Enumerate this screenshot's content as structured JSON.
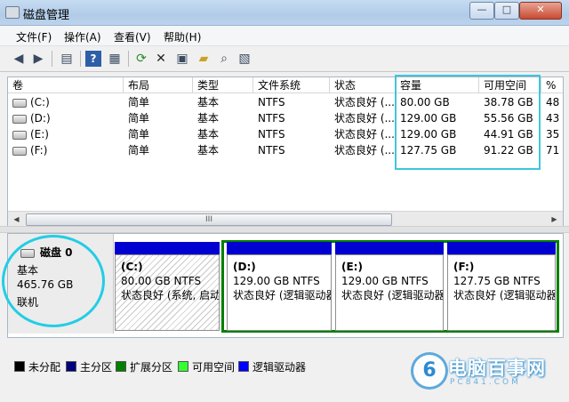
{
  "window": {
    "title": "磁盘管理",
    "controls": {
      "minimize": "—",
      "maximize": "□",
      "close": "✕"
    }
  },
  "menu": [
    "文件(F)",
    "操作(A)",
    "查看(V)",
    "帮助(H)"
  ],
  "toolbar_icons": [
    "back-arrow-icon",
    "forward-arrow-icon",
    "console-tree-icon",
    "help-icon",
    "properties-icon",
    "refresh-icon",
    "delete-icon",
    "export-icon",
    "open-icon",
    "search-icon",
    "settings-icon"
  ],
  "volume_table": {
    "columns": [
      "卷",
      "布局",
      "类型",
      "文件系统",
      "状态",
      "容量",
      "可用空间",
      "%"
    ],
    "rows": [
      [
        "(C:)",
        "简单",
        "基本",
        "NTFS",
        "状态良好 (...",
        "80.00 GB",
        "38.78 GB",
        "48"
      ],
      [
        "(D:)",
        "简单",
        "基本",
        "NTFS",
        "状态良好 (...",
        "129.00 GB",
        "55.56 GB",
        "43"
      ],
      [
        "(E:)",
        "简单",
        "基本",
        "NTFS",
        "状态良好 (...",
        "129.00 GB",
        "44.91 GB",
        "35"
      ],
      [
        "(F:)",
        "简单",
        "基本",
        "NTFS",
        "状态良好 (...",
        "127.75 GB",
        "91.22 GB",
        "71"
      ]
    ]
  },
  "disk": {
    "name": "磁盘 0",
    "type": "基本",
    "size": "465.76 GB",
    "status": "联机"
  },
  "partitions": [
    {
      "name": "(C:)",
      "size_fs": "80.00 GB NTFS",
      "status": "状态良好 (系统, 启动"
    },
    {
      "name": "(D:)",
      "size_fs": "129.00 GB NTFS",
      "status": "状态良好 (逻辑驱动器"
    },
    {
      "name": "(E:)",
      "size_fs": "129.00 GB NTFS",
      "status": "状态良好 (逻辑驱动器"
    },
    {
      "name": "(F:)",
      "size_fs": "127.75 GB NTFS",
      "status": "状态良好 (逻辑驱动器"
    }
  ],
  "legend": [
    {
      "label": "未分配",
      "color": "#000000"
    },
    {
      "label": "主分区",
      "color": "#00007f"
    },
    {
      "label": "扩展分区",
      "color": "#008000"
    },
    {
      "label": "可用空间",
      "color": "#33ff33"
    },
    {
      "label": "逻辑驱动器",
      "color": "#0000ff"
    }
  ],
  "scrollbar": {
    "thumb_grip": "III"
  },
  "watermark": {
    "logo": "6",
    "text": "电脑百事网",
    "sub": "PC841.COM"
  },
  "colors": {
    "highlight": "#3ec6dd",
    "partition_bar": "#0000d0",
    "extended_border": "#008000"
  }
}
